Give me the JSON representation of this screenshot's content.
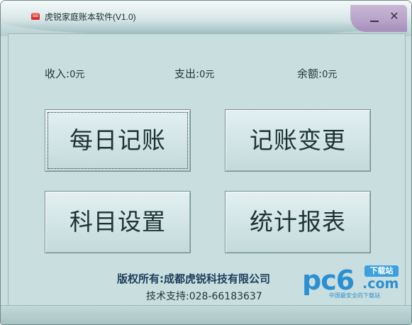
{
  "window": {
    "title": "虎锐家庭账本软件(V1.0)",
    "icon": "ledger-book-icon",
    "controls": {
      "minimize_icon": "minimize-icon",
      "close_icon": "close-icon",
      "close_glyph": "✕"
    }
  },
  "summary": {
    "income_label": "收入:",
    "income_value": "0元",
    "expense_label": "支出:",
    "expense_value": "0元",
    "balance_label": "余额:",
    "balance_value": "0元"
  },
  "buttons": {
    "daily": "每日记账",
    "change": "记账变更",
    "subjects": "科目设置",
    "report": "统计报表"
  },
  "footer": {
    "copyright": "版权所有:成都虎锐科技有限公司",
    "support": "技术支持:028-66183637"
  },
  "watermark": {
    "brand_main": "pc6",
    "brand_com": ".com",
    "brand_badge": "下载站",
    "brand_slogan": "中国最安全的下载站"
  },
  "colors": {
    "accent": "#2b8fd1",
    "panel": "#c8dedf",
    "button_text": "#1e3133"
  }
}
